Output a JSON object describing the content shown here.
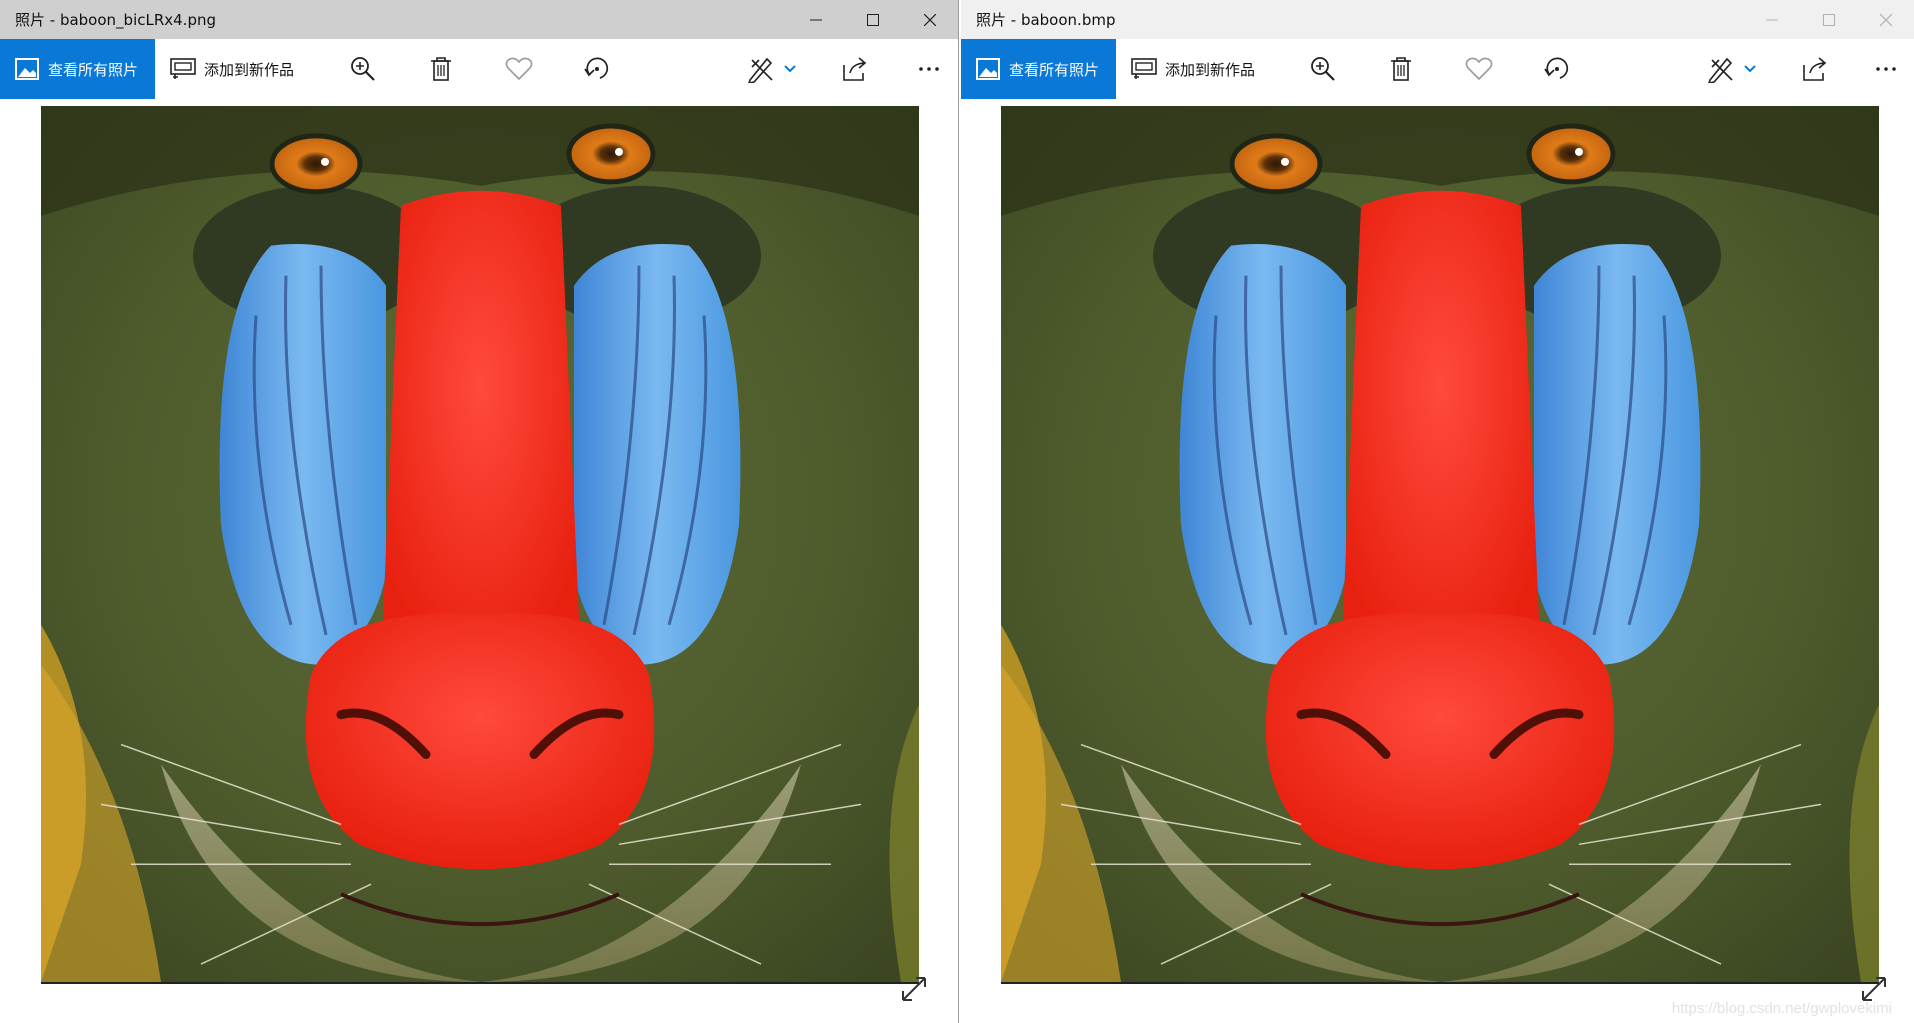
{
  "windows": {
    "left": {
      "title": "照片 - baboon_bicLRx4.png",
      "active": true
    },
    "right": {
      "title": "照片 - baboon.bmp",
      "active": false
    }
  },
  "toolbar": {
    "view_all_label": "查看所有照片",
    "add_to_creation_label": "添加到新作品",
    "icons": [
      "photos-app-icon",
      "add-to-creation-icon",
      "zoom-in-icon",
      "delete-icon",
      "favorite-heart-icon",
      "rotate-icon",
      "edit-draw-icon",
      "chevron-down-icon",
      "share-icon",
      "more-icon"
    ]
  },
  "caption_buttons": [
    "minimize-icon",
    "maximize-icon",
    "close-icon"
  ],
  "colors": {
    "accent": "#0a78d7",
    "titlebar_active": "#cfcfcf",
    "titlebar_inactive": "#f0f0f0",
    "photo_fur": "#4c5a2c",
    "photo_nose": "#f22a1e",
    "photo_cheeks": "#4fa0e8",
    "photo_eyes": "#e0801c"
  },
  "watermark": "https://blog.csdn.net/gwplovekimi"
}
